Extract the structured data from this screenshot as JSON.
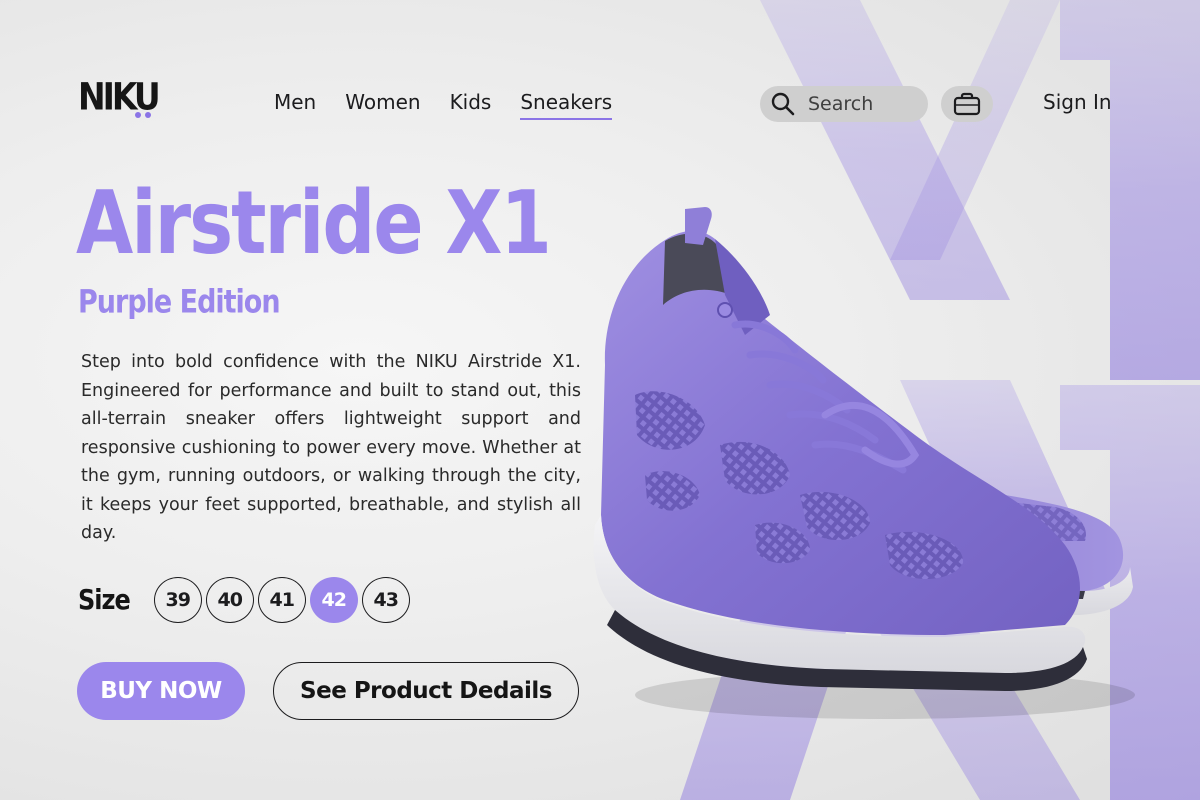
{
  "brand": {
    "logo_text": "NIKU"
  },
  "nav": {
    "items": [
      {
        "label": "Men",
        "active": false
      },
      {
        "label": "Women",
        "active": false
      },
      {
        "label": "Kids",
        "active": false
      },
      {
        "label": "Sneakers",
        "active": true
      }
    ]
  },
  "search": {
    "placeholder": "Search",
    "value": ""
  },
  "header": {
    "signin_label": "Sign In"
  },
  "icons": {
    "search": "search-icon",
    "cart": "shopping-bag-icon"
  },
  "product": {
    "name": "Airstride X1",
    "edition": "Purple Edition",
    "description": "Step into bold confidence with the NIKU Airstride X1. Engineered for performance and built to stand out, this all-terrain sneaker offers lightweight support and responsive cushioning to power every move. Whether at the gym, running outdoors, or walking through the city, it keeps your feet supported, breathable, and stylish all day.",
    "size_label": "Size",
    "sizes": [
      "39",
      "40",
      "41",
      "42",
      "43"
    ],
    "selected_size": "42",
    "watermark_text": "X1"
  },
  "actions": {
    "buy_label": "BUY NOW",
    "details_label": "See Product Dedails"
  },
  "colors": {
    "accent": "#9b87ec",
    "accent_dark": "#8b74e6",
    "text": "#1c1c1e",
    "pill_bg": "#cfcfcf"
  }
}
